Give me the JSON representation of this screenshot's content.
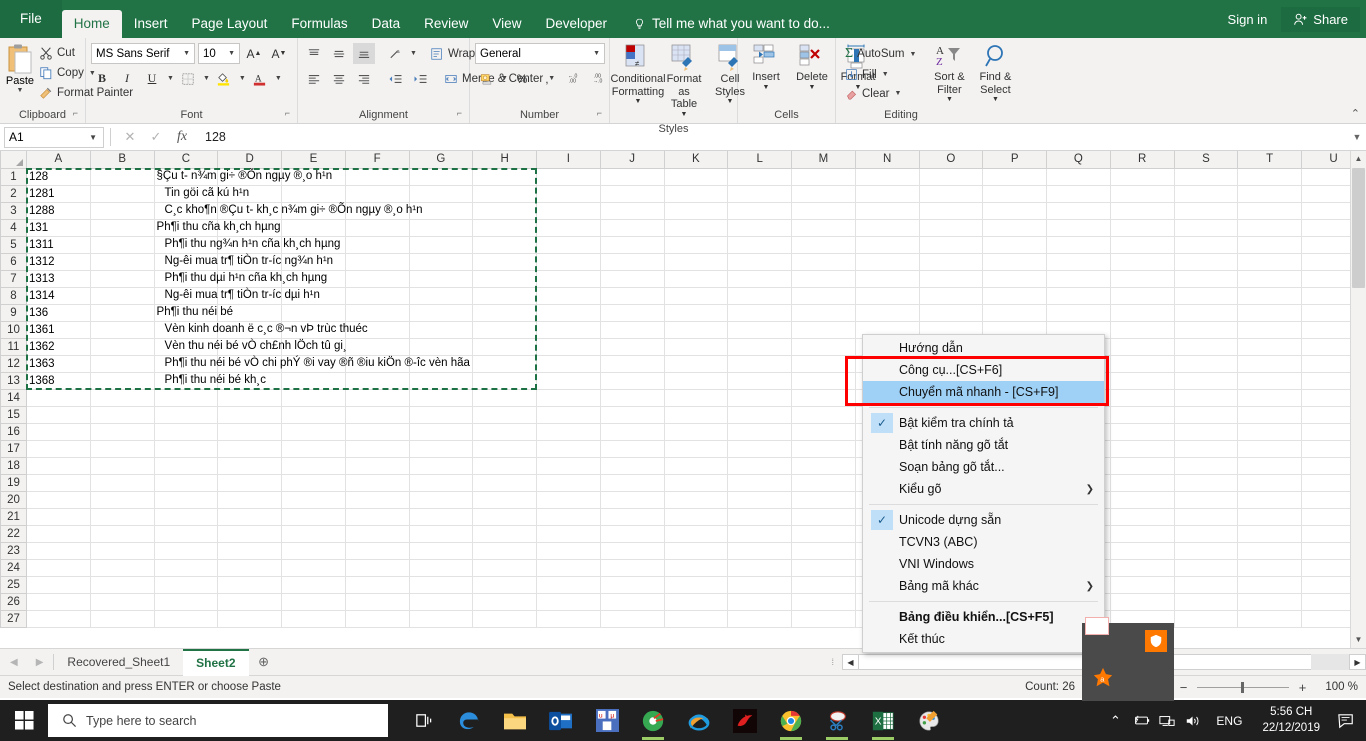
{
  "ribbon": {
    "tabs": [
      {
        "label": "File",
        "active": false,
        "file": true
      },
      {
        "label": "Home",
        "active": true
      },
      {
        "label": "Insert",
        "active": false
      },
      {
        "label": "Page Layout",
        "active": false
      },
      {
        "label": "Formulas",
        "active": false
      },
      {
        "label": "Data",
        "active": false
      },
      {
        "label": "Review",
        "active": false
      },
      {
        "label": "View",
        "active": false
      },
      {
        "label": "Developer",
        "active": false
      }
    ],
    "tellme": "Tell me what you want to do...",
    "signin": "Sign in",
    "share": "Share",
    "groups": {
      "clipboard": {
        "label": "Clipboard",
        "paste": "Paste",
        "cut": "Cut",
        "copy": "Copy",
        "format_painter": "Format Painter"
      },
      "font": {
        "label": "Font",
        "font_name": "MS Sans Serif",
        "font_size": "10",
        "bold": "B",
        "italic": "I",
        "underline": "U"
      },
      "alignment": {
        "label": "Alignment",
        "wrap_text": "Wrap Text",
        "merge_center": "Merge & Center"
      },
      "number": {
        "label": "Number",
        "format": "General",
        "percent": "%",
        "comma": ","
      },
      "styles": {
        "label": "Styles",
        "conditional_formatting": "Conditional Formatting",
        "format_as_table": "Format as Table",
        "cell_styles": "Cell Styles"
      },
      "cells": {
        "label": "Cells",
        "insert": "Insert",
        "delete": "Delete",
        "format": "Format"
      },
      "editing": {
        "label": "Editing",
        "autosum": "AutoSum",
        "fill": "Fill",
        "clear": "Clear",
        "sort_filter": "Sort & Filter",
        "find_select": "Find & Select"
      }
    }
  },
  "formula_bar": {
    "name_box": "A1",
    "value": "128"
  },
  "grid": {
    "columns": [
      "A",
      "B",
      "C",
      "D",
      "E",
      "F",
      "G",
      "H",
      "I",
      "J",
      "K",
      "L",
      "M",
      "N",
      "O",
      "P",
      "Q",
      "R",
      "S",
      "T",
      "U"
    ],
    "row_count": 27,
    "rows": [
      {
        "n": 1,
        "a": "128",
        "indent": 0,
        "c": "§Çu t- n¾m gi÷ ®Õn ngµy ®¸o h¹n"
      },
      {
        "n": 2,
        "a": "1281",
        "indent": 1,
        "c": "Tin göi cã kú h¹n"
      },
      {
        "n": 3,
        "a": "1288",
        "indent": 1,
        "c": "C¸c kho¶n ®Çu t- kh¸c n¾m gi÷ ®Õn ngµy ®¸o h¹n"
      },
      {
        "n": 4,
        "a": "131",
        "indent": 0,
        "c": "Ph¶i thu cña kh¸ch hµng"
      },
      {
        "n": 5,
        "a": "1311",
        "indent": 1,
        "c": "Ph¶i thu ng¾n h¹n cña kh¸ch hµng"
      },
      {
        "n": 6,
        "a": "1312",
        "indent": 1,
        "c": "Ng-êi mua tr¶ tiÒn tr-íc ng¾n h¹n"
      },
      {
        "n": 7,
        "a": "1313",
        "indent": 1,
        "c": "Ph¶i thu dµi h¹n cña kh¸ch hµng"
      },
      {
        "n": 8,
        "a": "1314",
        "indent": 1,
        "c": "Ng-êi mua tr¶ tiÒn tr-íc dµi h¹n"
      },
      {
        "n": 9,
        "a": "136",
        "indent": 0,
        "c": "Ph¶i thu néi bé"
      },
      {
        "n": 10,
        "a": "1361",
        "indent": 1,
        "c": "Vèn kinh doanh ë c¸c ®¬n vÞ trùc thuéc"
      },
      {
        "n": 11,
        "a": "1362",
        "indent": 1,
        "c": "Vèn thu néi bé vÒ ch£nh lÖch tû gi¸"
      },
      {
        "n": 12,
        "a": "1363",
        "indent": 1,
        "c": "Ph¶i thu néi bé vÒ chi phÝ ®i vay ®ñ ®iu kiÖn ®-îc vèn hãa"
      },
      {
        "n": 13,
        "a": "1368",
        "indent": 1,
        "c": "Ph¶i thu néi bé kh¸c"
      }
    ]
  },
  "context_menu": {
    "items": [
      {
        "label": "Hướng dẫn",
        "checked": false,
        "selected": false,
        "submenu": false,
        "bold": false
      },
      {
        "label": "Công cụ...[CS+F6]",
        "checked": false,
        "selected": false,
        "submenu": false,
        "bold": false
      },
      {
        "label": "Chuyển mã nhanh - [CS+F9]",
        "checked": false,
        "selected": true,
        "submenu": false,
        "bold": false
      },
      {
        "separator": true
      },
      {
        "label": "Bật kiểm tra chính tả",
        "checked": true,
        "selected": false,
        "submenu": false,
        "bold": false
      },
      {
        "label": "Bật tính năng gõ tắt",
        "checked": false,
        "selected": false,
        "submenu": false,
        "bold": false
      },
      {
        "label": "Soạn bảng gõ tắt...",
        "checked": false,
        "selected": false,
        "submenu": false,
        "bold": false
      },
      {
        "label": "Kiểu gõ",
        "checked": false,
        "selected": false,
        "submenu": true,
        "bold": false
      },
      {
        "separator": true
      },
      {
        "label": "Unicode dựng sẵn",
        "checked": true,
        "selected": false,
        "submenu": false,
        "bold": false
      },
      {
        "label": "TCVN3 (ABC)",
        "checked": false,
        "selected": false,
        "submenu": false,
        "bold": false
      },
      {
        "label": "VNI Windows",
        "checked": false,
        "selected": false,
        "submenu": false,
        "bold": false
      },
      {
        "label": "Bảng mã khác",
        "checked": false,
        "selected": false,
        "submenu": true,
        "bold": false
      },
      {
        "separator": true
      },
      {
        "label": "Bảng điều khiển...[CS+F5]",
        "checked": false,
        "selected": false,
        "submenu": false,
        "bold": true
      },
      {
        "label": "Kết thúc",
        "checked": false,
        "selected": false,
        "submenu": false,
        "bold": false
      }
    ],
    "highlight_color": "#ff0000"
  },
  "sheet_tabs": {
    "tabs": [
      {
        "label": "Recovered_Sheet1",
        "active": false
      },
      {
        "label": "Sheet2",
        "active": true
      }
    ],
    "add_label": "+"
  },
  "status_bar": {
    "message": "Select destination and press ENTER or choose Paste",
    "count": "Count: 26",
    "zoom": "100 %"
  },
  "taskbar": {
    "search_placeholder": "Type here to search",
    "language": "ENG",
    "time": "5:56 CH",
    "date": "22/12/2019"
  }
}
